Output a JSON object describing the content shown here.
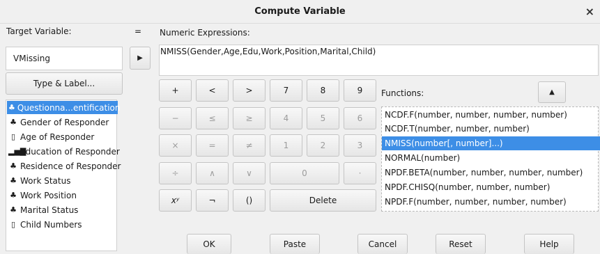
{
  "window": {
    "title": "Compute Variable",
    "close_glyph": "×"
  },
  "target": {
    "equals": "=",
    "label": "Target Variable:",
    "value": "VMissing",
    "type_label_button": "Type & Label..."
  },
  "variables": [
    {
      "label": "Questionna...entification",
      "icon": "nominal-icon",
      "selected": true
    },
    {
      "label": "Gender of Responder",
      "icon": "nominal-icon",
      "selected": false
    },
    {
      "label": "Age of Responder",
      "icon": "scale-icon",
      "selected": false
    },
    {
      "label": "Education of Responder",
      "icon": "ordinal-icon",
      "selected": false
    },
    {
      "label": "Residence of Responder",
      "icon": "nominal-icon",
      "selected": false
    },
    {
      "label": "Work Status",
      "icon": "nominal-icon",
      "selected": false
    },
    {
      "label": "Work Position",
      "icon": "nominal-icon",
      "selected": false
    },
    {
      "label": "Marital Status",
      "icon": "nominal-icon",
      "selected": false
    },
    {
      "label": "Child Numbers",
      "icon": "scale-icon",
      "selected": false
    }
  ],
  "expression": {
    "label": "Numeric Expressions:",
    "value": "NMISS(Gender,Age,Edu,Work,Position,Marital,Child)"
  },
  "keypad": {
    "plus": "+",
    "less": "<",
    "greater": ">",
    "seven": "7",
    "eight": "8",
    "nine": "9",
    "minus": "−",
    "less_equal": "≤",
    "greater_equal": "≥",
    "four": "4",
    "five": "5",
    "six": "6",
    "multiply": "×",
    "equal": "=",
    "not_equal": "≠",
    "one": "1",
    "two": "2",
    "three": "3",
    "divide": "÷",
    "and": "∧",
    "or": "∨",
    "zero": "0",
    "dot": "·",
    "power": "xʸ",
    "not": "¬",
    "parens": "()",
    "delete": "Delete"
  },
  "functions": {
    "label": "Functions:",
    "items": [
      {
        "label": "NCDF.F(number, number, number, number)",
        "selected": false
      },
      {
        "label": "NCDF.T(number, number, number)",
        "selected": false
      },
      {
        "label": "NMISS(number[, number]...)",
        "selected": true
      },
      {
        "label": "NORMAL(number)",
        "selected": false
      },
      {
        "label": "NPDF.BETA(number, number, number, number)",
        "selected": false
      },
      {
        "label": "NPDF.CHISQ(number, number, number)",
        "selected": false
      },
      {
        "label": "NPDF.F(number, number, number, number)",
        "selected": false
      }
    ]
  },
  "footer": {
    "ok": "OK",
    "paste": "Paste",
    "cancel": "Cancel",
    "reset": "Reset",
    "help": "Help"
  },
  "colors": {
    "selection": "#3d8ee6",
    "background": "#f0f0f0"
  }
}
